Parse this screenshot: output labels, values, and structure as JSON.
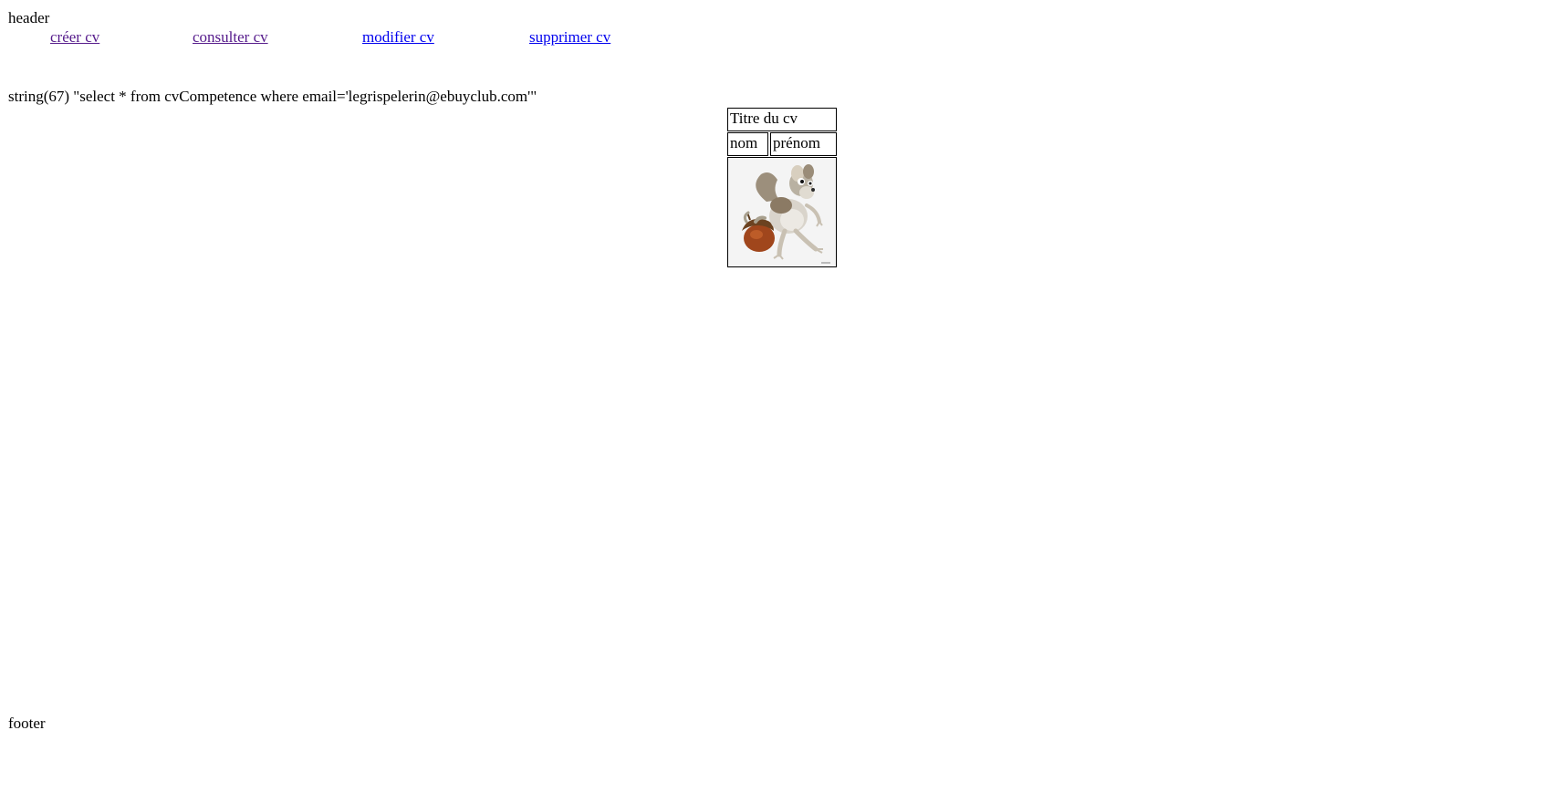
{
  "header": {
    "label": "header"
  },
  "nav": {
    "items": [
      {
        "label": "créer cv"
      },
      {
        "label": "consulter cv"
      },
      {
        "label": "modifier cv"
      },
      {
        "label": "supprimer cv"
      }
    ]
  },
  "debug": {
    "text": "string(67) \"select * from cvCompetence where email='legrispelerin@ebuyclub.com'\""
  },
  "cv": {
    "title": "Titre du cv",
    "nom": "nom",
    "prenom": "prénom",
    "photo_icon": "squirrel-with-acorn-image"
  },
  "footer": {
    "label": "footer"
  },
  "colors": {
    "link_unvisited": "#0000ee",
    "link_visited": "#551a8b"
  }
}
